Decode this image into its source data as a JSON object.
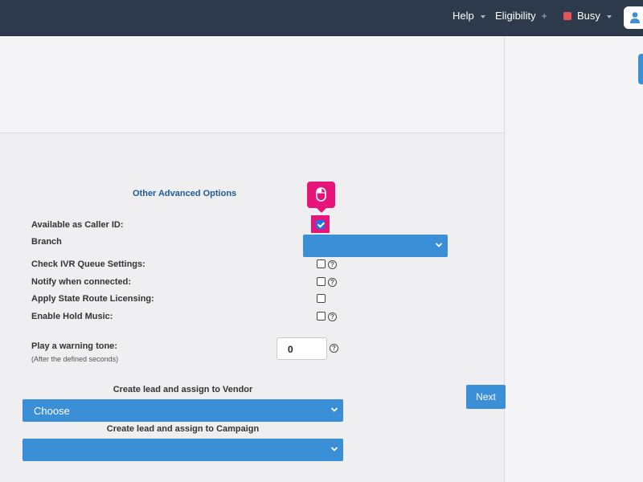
{
  "topbar": {
    "help_label": "Help",
    "eligibility_label": "Eligibility",
    "eligibility_suffix": "+",
    "status_label": "Busy",
    "status_color": "#e2555b"
  },
  "form": {
    "section_title": "Other Advanced Options",
    "caller_id_label": "Available as Caller ID:",
    "caller_id_checked": true,
    "branch_label": "Branch",
    "branch_value": "",
    "ivr_label": "Check IVR Queue Settings:",
    "notify_label": "Notify when connected:",
    "state_route_label": "Apply State Route Licensing:",
    "hold_music_label": "Enable Hold Music:",
    "warning_tone_label": "Play a warning tone:",
    "warning_tone_sublabel": "(After the defined seconds)",
    "warning_tone_value": "0",
    "vendor_label": "Create lead and assign to Vendor",
    "vendor_value": "Choose",
    "campaign_label": "Create lead and assign to Campaign",
    "campaign_value": "",
    "next_label": "Next",
    "help_glyph": "?"
  },
  "colors": {
    "accent": "#3b8fd6",
    "highlight": "#e6157a",
    "topbar": "#2d3a4b"
  }
}
